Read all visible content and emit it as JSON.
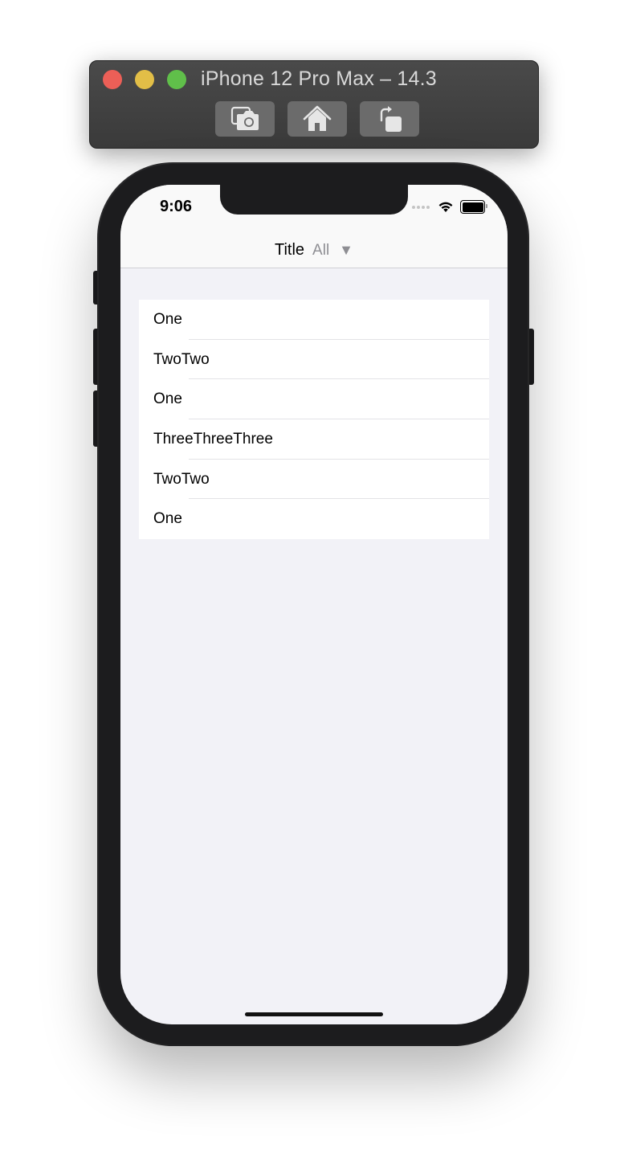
{
  "simulator": {
    "title": "iPhone 12 Pro Max – 14.3",
    "buttons": [
      {
        "name": "screenshot",
        "icon": "camera-icon"
      },
      {
        "name": "home",
        "icon": "home-icon"
      },
      {
        "name": "rotate",
        "icon": "rotate-icon"
      }
    ],
    "colors": {
      "close": "#ec5f57",
      "minimize": "#e2be47",
      "maximize": "#60bf4a"
    }
  },
  "status_bar": {
    "time": "9:06",
    "icons": [
      "signal-dots-icon",
      "wifi-icon",
      "battery-icon"
    ]
  },
  "nav_bar": {
    "title": "Title",
    "filter_value": "All",
    "filter_indicator": "▼"
  },
  "list": {
    "items": [
      {
        "label": "One"
      },
      {
        "label": "TwoTwo"
      },
      {
        "label": "One"
      },
      {
        "label": "ThreeThreeThree"
      },
      {
        "label": "TwoTwo"
      },
      {
        "label": "One"
      }
    ]
  }
}
